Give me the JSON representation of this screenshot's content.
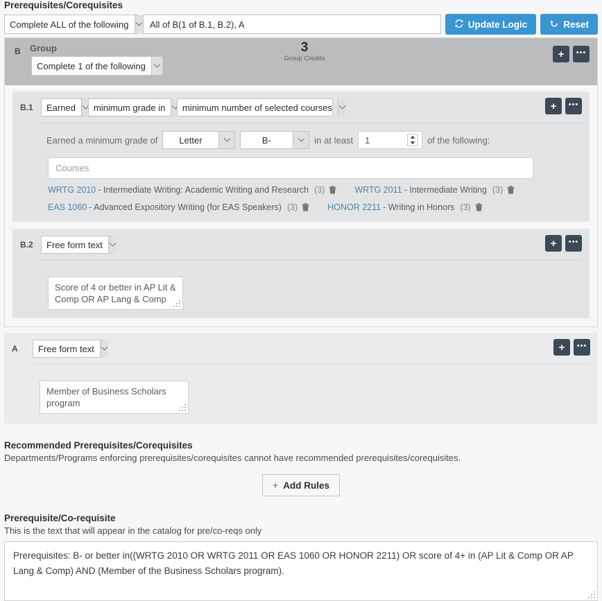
{
  "prereq": {
    "title": "Prerequisites/Corequisites",
    "mode_select": "Complete ALL of the following",
    "logic_expression": "All of B(1 of B.1, B.2), A",
    "update_logic_label": "Update Logic",
    "reset_label": "Reset",
    "accent_blue": "#3a95d3"
  },
  "group_b": {
    "letter": "B",
    "title": "Group",
    "mode_select": "Complete 1 of the following",
    "credits_value": "3",
    "credits_label": "Group Credits"
  },
  "rule_b1": {
    "letter": "B.1",
    "select_1": "Earned",
    "select_2": "minimum grade in",
    "select_3": "minimum number of selected courses",
    "criteria_prefix": "Earned a minimum grade of",
    "grade_type": "Letter",
    "grade_value": "B-",
    "criteria_mid": "in at least",
    "count_value": "1",
    "criteria_suffix": "of the following:",
    "courses_placeholder": "Courses",
    "courses": [
      [
        {
          "code": "WRTG 2010",
          "name": "- Intermediate Writing: Academic Writing and Research",
          "credits": "(3)"
        },
        {
          "code": "WRTG 2011",
          "name": "- Intermediate Writing",
          "credits": "(3)"
        }
      ],
      [
        {
          "code": "EAS 1060",
          "name": "- Advanced Expository Writing (for EAS Speakers)",
          "credits": "(3)"
        },
        {
          "code": "HONOR 2211",
          "name": "- Writing in Honors",
          "credits": "(3)"
        }
      ]
    ]
  },
  "rule_b2": {
    "letter": "B.2",
    "select_1": "Free form text",
    "free_text": "Score of 4 or better in AP Lit & Comp OR AP Lang & Comp"
  },
  "rule_a": {
    "letter": "A",
    "select_1": "Free form text",
    "free_text": "Member of Business Scholars program"
  },
  "recommended": {
    "title": "Recommended Prerequisites/Corequisites",
    "note": "Departments/Programs enforcing prerequisites/corequisites cannot have recommended prerequisites/corequisites.",
    "add_rules_label": "Add Rules"
  },
  "catalog": {
    "title": "Prerequisite/Co-requisite",
    "subtitle": "This is the text that will appear in the catalog for pre/co-reqs only",
    "text": "Prerequisites: B- or better in((WRTG 2010 OR WRTG 2011 OR EAS 1060 OR HONOR 2211) OR score of 4+ in (AP Lit & Comp OR AP Lang & Comp) AND (Member of the Business Scholars program)."
  },
  "icons": {
    "refresh": "refresh-icon",
    "undo": "undo-icon",
    "plus": "+",
    "dots": "•••",
    "trash": "trash-icon"
  }
}
